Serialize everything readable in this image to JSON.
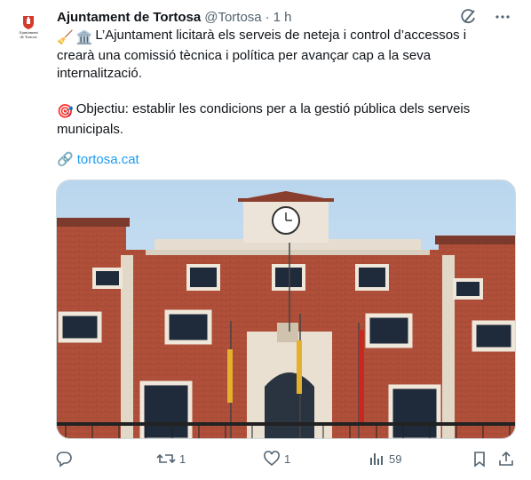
{
  "account": {
    "name": "Ajuntament de Tortosa",
    "handle": "@Tortosa",
    "separator": "·",
    "time": "1 h",
    "avatar_logo_line1": "Ajuntament",
    "avatar_logo_line2": "de Tortosa"
  },
  "tweet": {
    "emoji_1": "🧹",
    "emoji_2": "🏛️",
    "line_1": "L’Ajuntament licitarà els serveis de neteja i control d’accessos i crearà una comissió tècnica i política per avançar cap a la seva internalització.",
    "emoji_3": "🎯",
    "line_2": "Objectiu: establir les condicions per a la gestió pública dels serveis municipals.",
    "link_emoji": "🔗",
    "link_text": "tortosa.cat"
  },
  "header_icons": [
    "grok-icon",
    "more-icon"
  ],
  "actions": {
    "reply_count": "",
    "retweet_count": "1",
    "like_count": "1",
    "views_count": "59",
    "bookmark_count": "",
    "share_count": ""
  },
  "colors": {
    "text": "#0f1419",
    "secondary": "#536471",
    "link": "#1d9bf0",
    "border": "#cfd9de",
    "brick": "#b24a36",
    "sky": "#cfe3f3"
  }
}
